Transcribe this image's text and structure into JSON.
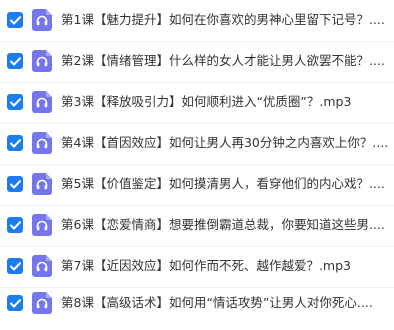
{
  "colors": {
    "checkbox": "#1e7cf2",
    "audio_icon": "#7575ee",
    "text": "#333333"
  },
  "files": [
    {
      "name": "第1课【魅力提升】如何在你喜欢的男神心里留下记号？....",
      "checked": true,
      "icon": "audio-headphones-icon"
    },
    {
      "name": "第2课【情绪管理】什么样的女人才能让男人欲罢不能？....",
      "checked": true,
      "icon": "audio-headphones-icon"
    },
    {
      "name": "第3课【释放吸引力】如何顺利进入“优质圈”？.mp3",
      "checked": true,
      "icon": "audio-headphones-icon"
    },
    {
      "name": "第4课【首因效应】如何让男人再30分钟之内喜欢上你？....",
      "checked": true,
      "icon": "audio-headphones-icon"
    },
    {
      "name": "第5课【价值鉴定】如何摸清男人，看穿他们的内心戏？....",
      "checked": true,
      "icon": "audio-headphones-icon"
    },
    {
      "name": "第6课【恋爱情商】想要推倒霸道总裁，你要知道这些男....",
      "checked": true,
      "icon": "audio-headphones-icon"
    },
    {
      "name": "第7课【近因效应】如何作而不死、越作越爱？.mp3",
      "checked": true,
      "icon": "audio-headphones-icon"
    },
    {
      "name": "第8课【高级话术】如何用“情话攻势”让男人对你死心....",
      "checked": true,
      "icon": "audio-headphones-icon"
    }
  ]
}
